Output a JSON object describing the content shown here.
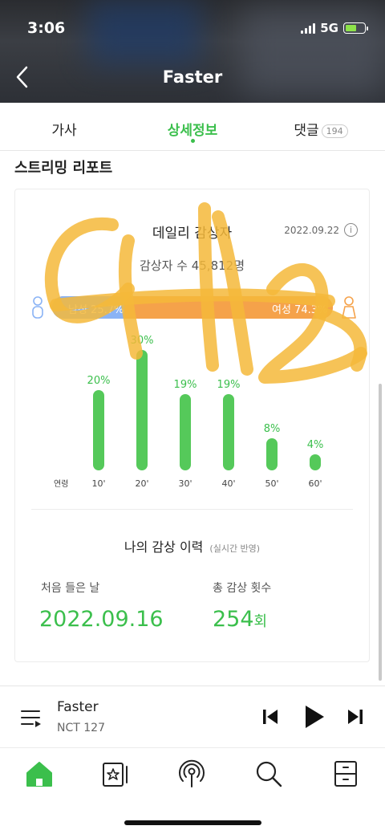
{
  "status_bar": {
    "time": "3:06",
    "network": "5G"
  },
  "header": {
    "title": "Faster"
  },
  "tabs": [
    {
      "label": "가사"
    },
    {
      "label": "상세정보"
    },
    {
      "label": "댓글",
      "badge": "194"
    }
  ],
  "section_title": "스트리밍 리포트",
  "daily": {
    "title": "데일리 감상자",
    "date": "2022.09.22",
    "listener_text": "감상자 수 45,812명",
    "male_label": "남성 25.7%",
    "female_label": "여성 74.3%",
    "male_ratio": 0.257,
    "age_axis_label": "연령"
  },
  "chart_data": {
    "type": "bar",
    "categories": [
      "10'",
      "20'",
      "30'",
      "40'",
      "50'",
      "60'"
    ],
    "values": [
      20,
      30,
      19,
      19,
      8,
      4
    ],
    "value_labels": [
      "20%",
      "30%",
      "19%",
      "19%",
      "8%",
      "4%"
    ],
    "color": "#55c95a",
    "ylim": [
      0,
      30
    ]
  },
  "history": {
    "title": "나의 감상 이력",
    "note": "(실시간 반영)",
    "first_listen_label": "처음 들은 날",
    "first_listen_value": "2022.09.16",
    "count_label": "총 감상 횟수",
    "count_value": "254",
    "count_unit": "회"
  },
  "player": {
    "song": "Faster",
    "artist": "NCT 127"
  },
  "colors": {
    "accent": "#3bbf4c",
    "male": "#8ab3f5",
    "female": "#f5a24a",
    "scribble": "#f5b93a"
  }
}
